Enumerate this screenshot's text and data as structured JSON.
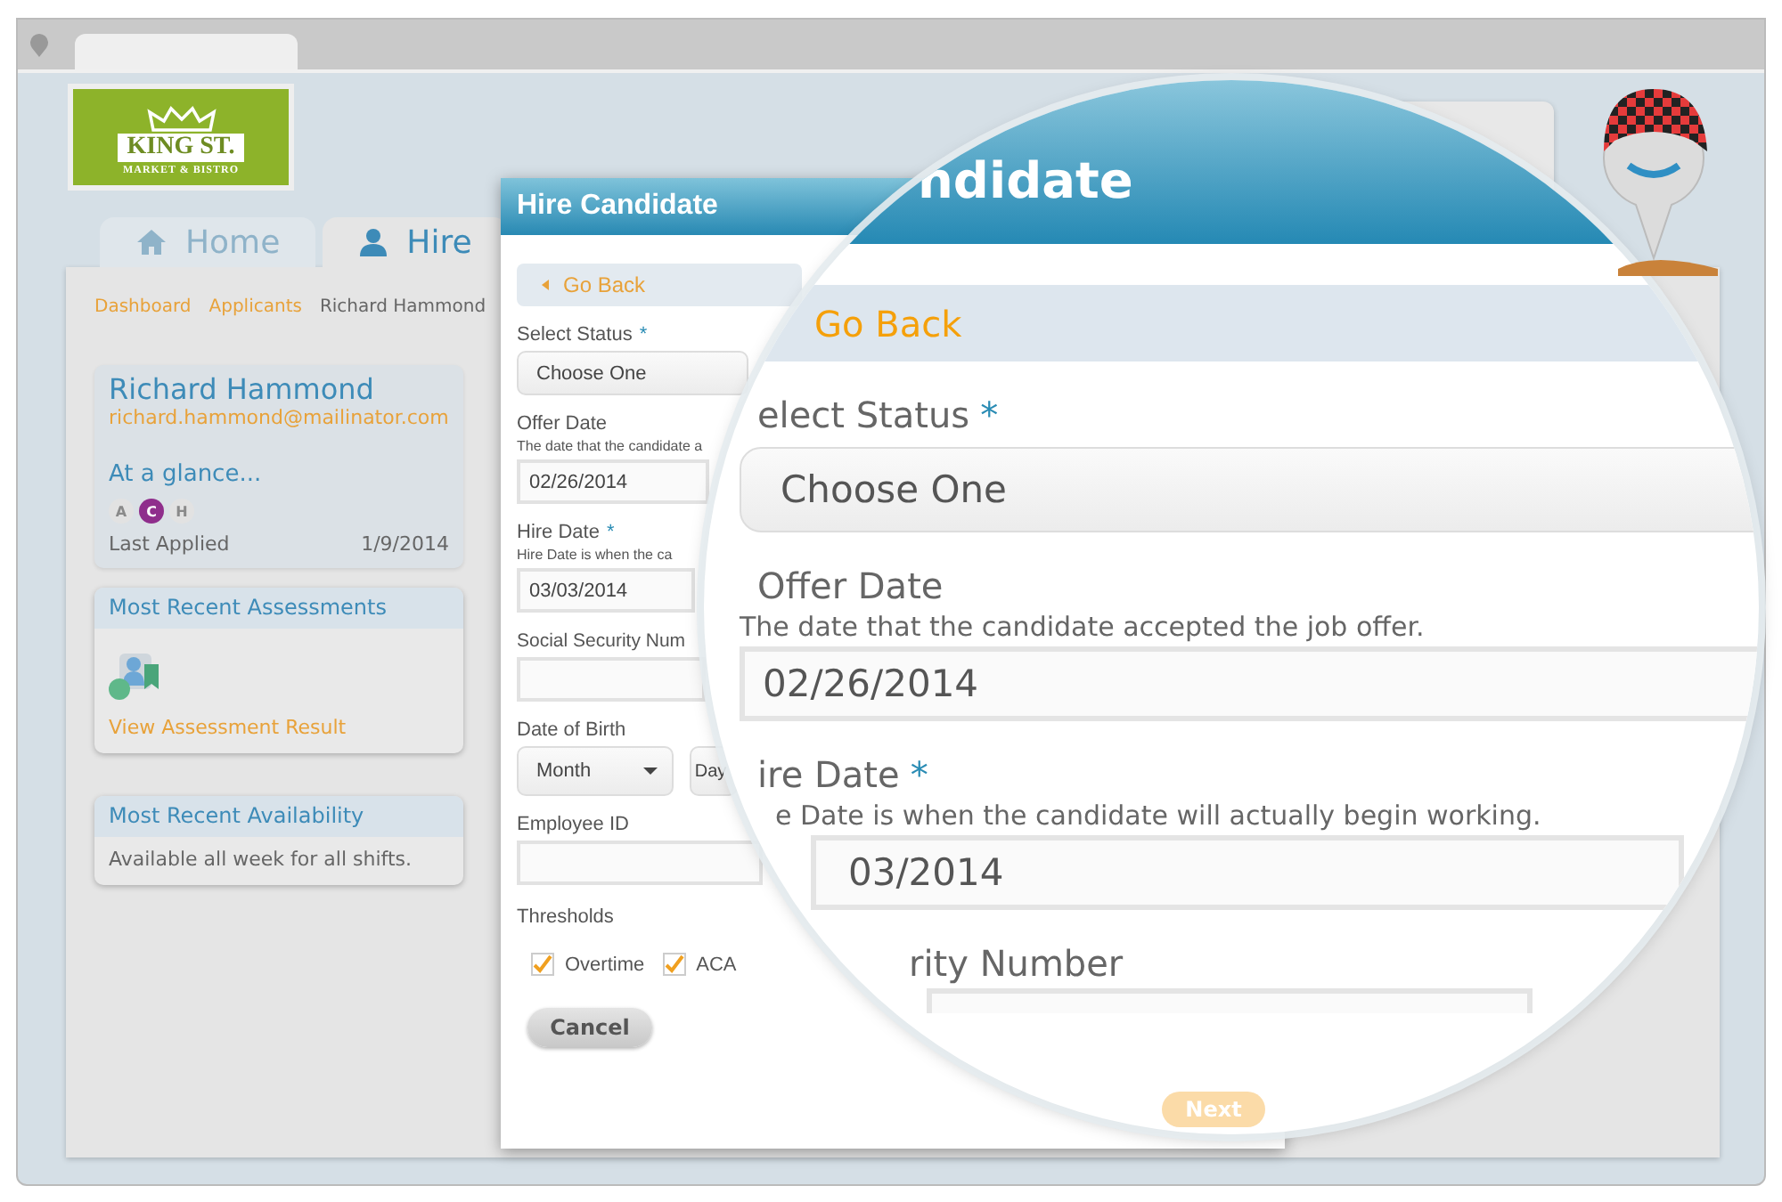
{
  "logo": {
    "name": "KING ST.",
    "subtitle": "MARKET & BISTRO"
  },
  "tabs": [
    {
      "label": "Home",
      "selected": false
    },
    {
      "label": "Hire",
      "selected": true
    }
  ],
  "breadcrumb": [
    {
      "label": "Dashboard",
      "link": true
    },
    {
      "label": "Applicants",
      "link": true
    },
    {
      "label": "Richard Hammond",
      "link": false
    }
  ],
  "candidate": {
    "name": "Richard Hammond",
    "email": "richard.hammond@mailinator.com",
    "glance_title": "At a glance...",
    "badges": [
      {
        "letter": "A",
        "selected": false
      },
      {
        "letter": "C",
        "selected": true
      },
      {
        "letter": "H",
        "selected": false
      }
    ],
    "last_applied_label": "Last Applied",
    "last_applied": "1/9/2014"
  },
  "assessments": {
    "title": "Most Recent Assessments",
    "link": "View Assessment Result"
  },
  "availability": {
    "title": "Most Recent Availability",
    "text": "Available all week for all shifts."
  },
  "modal": {
    "title": "Hire Candidate",
    "back": "Go Back",
    "fields": [
      {
        "kind": "select",
        "label": "Select Status",
        "required_mark": "*",
        "value": "Choose One"
      },
      {
        "kind": "text",
        "label": "Offer Date",
        "hint": "The date that the candidate a",
        "value": "02/26/2014"
      },
      {
        "kind": "text",
        "label": "Hire Date",
        "required_mark": "*",
        "hint": "Hire Date is when the ca",
        "value": "03/03/2014"
      },
      {
        "kind": "text",
        "label": "Social Security Num"
      },
      {
        "kind": "dob",
        "label": "Date of Birth",
        "selects": [
          "Month",
          "Day"
        ]
      },
      {
        "kind": "text",
        "label": "Employee ID"
      }
    ],
    "thresholds": {
      "label": "Thresholds",
      "options": [
        {
          "label": "Overtime",
          "checked": true
        },
        {
          "label": "ACA",
          "checked": true
        }
      ]
    },
    "cancel": "Cancel"
  },
  "lens": {
    "title": "ndidate",
    "back": "Go Back",
    "fields": [
      {
        "kind": "select",
        "label": "elect Status",
        "required_mark": "*",
        "value": "Choose One"
      },
      {
        "kind": "text",
        "label": "Offer Date",
        "hint": "The date that the candidate accepted the job offer.",
        "value": "02/26/2014"
      },
      {
        "kind": "text",
        "label": "ire Date",
        "required_mark": "*",
        "hint": "e Date is when the candidate will actually begin working.",
        "value": "03/2014"
      },
      {
        "kind": "text",
        "label": "rity Number"
      }
    ],
    "next": "Next"
  }
}
